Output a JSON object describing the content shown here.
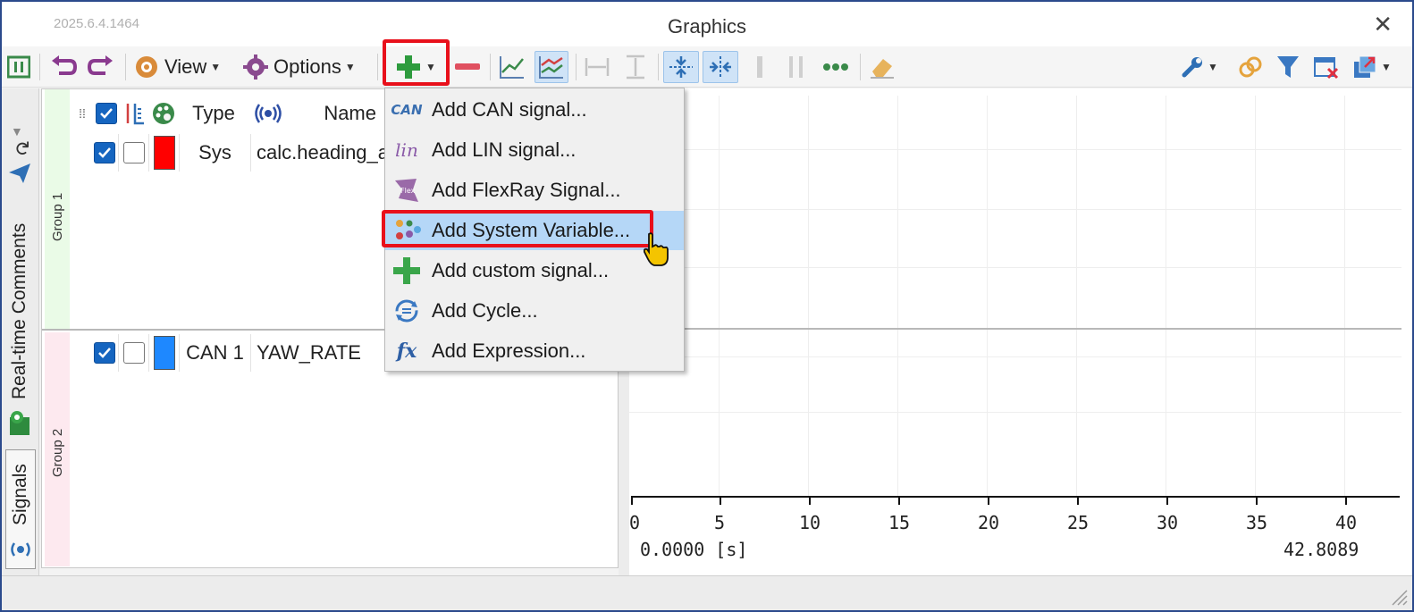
{
  "window": {
    "version": "2025.6.4.1464",
    "title": "Graphics",
    "close_glyph": "✕"
  },
  "toolbar": {
    "view_label": "View",
    "options_label": "Options"
  },
  "vertical_tabs": {
    "comments_label": "Real-time Comments",
    "signals_label": "Signals"
  },
  "signals_table": {
    "headers": {
      "type": "Type",
      "name": "Name"
    },
    "groups": [
      {
        "label": "Group 1",
        "band_color": "#eafbe7"
      },
      {
        "label": "Group 2",
        "band_color": "#fde9ef"
      }
    ],
    "rows": [
      {
        "type": "Sys",
        "name": "calc.heading_a",
        "color": "#ff0000",
        "visible": true,
        "locked": false
      },
      {
        "type": "CAN 1",
        "name": "YAW_RATE",
        "color": "#1e88ff",
        "visible": true,
        "locked": false
      }
    ]
  },
  "add_menu": {
    "items": [
      {
        "label": "Add CAN signal...",
        "icon": "can-icon"
      },
      {
        "label": "Add LIN signal...",
        "icon": "lin-icon"
      },
      {
        "label": "Add FlexRay Signal...",
        "icon": "flexray-icon"
      },
      {
        "label": "Add System Variable...",
        "icon": "system-variable-icon",
        "highlighted": true
      },
      {
        "label": "Add custom signal...",
        "icon": "plus-icon"
      },
      {
        "label": "Add Cycle...",
        "icon": "cycle-icon"
      },
      {
        "label": "Add Expression...",
        "icon": "fx-icon"
      }
    ],
    "can_glyph": "CAN",
    "lin_glyph": "lin",
    "flex_glyph": "Flex",
    "fx_glyph": "fx"
  },
  "graph": {
    "x_ticks": [
      "0",
      "5",
      "10",
      "15",
      "20",
      "25",
      "30",
      "35",
      "40"
    ],
    "x_start": "0.0000 [s]",
    "x_end": "42.8089"
  },
  "colors": {
    "accent": "#1565c0",
    "annotation": "#e8101b",
    "highlight": "#b5d7f7"
  }
}
